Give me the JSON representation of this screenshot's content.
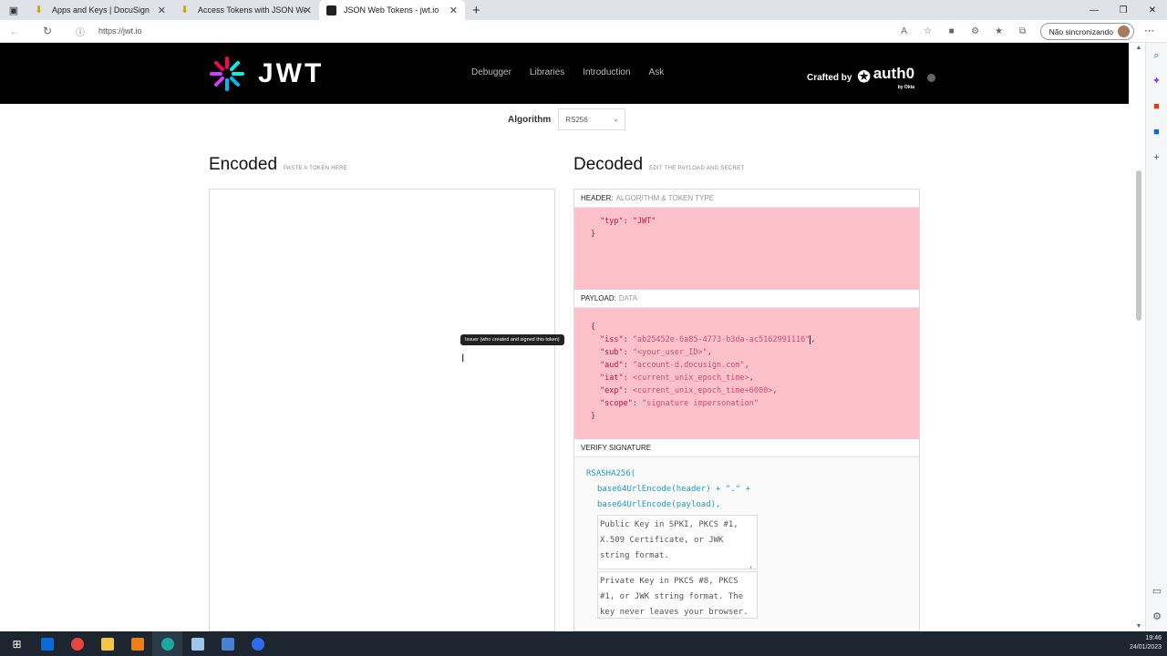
{
  "browser": {
    "tabs": [
      {
        "title": "Apps and Keys | DocuSign",
        "favicon": "download-icon",
        "active": false
      },
      {
        "title": "Access Tokens with JSON Web Tok",
        "favicon": "download-icon",
        "active": false
      },
      {
        "title": "JSON Web Tokens - jwt.io",
        "favicon": "jwt-icon",
        "active": true
      }
    ],
    "url": "https://jwt.io",
    "profile_label": "Não sincronizando"
  },
  "site": {
    "logo_text": "JWT",
    "nav": [
      "Debugger",
      "Libraries",
      "Introduction",
      "Ask"
    ],
    "crafted_by": "Crafted by",
    "brand": "auth0",
    "brand_sub": "by Okta"
  },
  "algorithm": {
    "label": "Algorithm",
    "value": "RS256"
  },
  "encoded": {
    "title": "Encoded",
    "hint": "PASTE A TOKEN HERE"
  },
  "decoded": {
    "title": "Decoded",
    "hint": "EDIT THE PAYLOAD AND SECRET",
    "header_label": "HEADER:",
    "header_sub": "ALGORITHM & TOKEN TYPE",
    "header_lines": [
      "\"typ\": \"JWT\"",
      "}"
    ],
    "payload_label": "PAYLOAD:",
    "payload_sub": "DATA",
    "payload_open": "{",
    "payload": [
      {
        "key": "\"iss\"",
        "value": "\"ab25452e-6a85-4773-b3da-ac5162991116\""
      },
      {
        "key": "\"sub\"",
        "value": "\"<your_user_ID>\""
      },
      {
        "key": "\"aud\"",
        "value": "\"account-d.docusign.com\""
      },
      {
        "key": "\"iat\"",
        "value": "<current_unix_epoch_time>"
      },
      {
        "key": "\"exp\"",
        "value": "<current_unix_epoch_time+6000>"
      },
      {
        "key": "\"scope\"",
        "value": "\"signature impersonation\""
      }
    ],
    "payload_close": "}",
    "verify_label": "VERIFY SIGNATURE",
    "verify_lines": [
      "RSASHA256(",
      "base64UrlEncode(header) + \".\" +",
      "base64UrlEncode(payload),"
    ],
    "public_key_placeholder": "Public Key in SPKI, PKCS #1, X.509 Certificate, or JWK string format.",
    "private_key_placeholder": "Private Key in PKCS #8, PKCS #1, or JWK string format. The key never leaves your browser."
  },
  "tooltip": "Issuer (who created and signed this token)",
  "taskbar": {
    "time": "19:46",
    "date": "24/01/2023"
  }
}
